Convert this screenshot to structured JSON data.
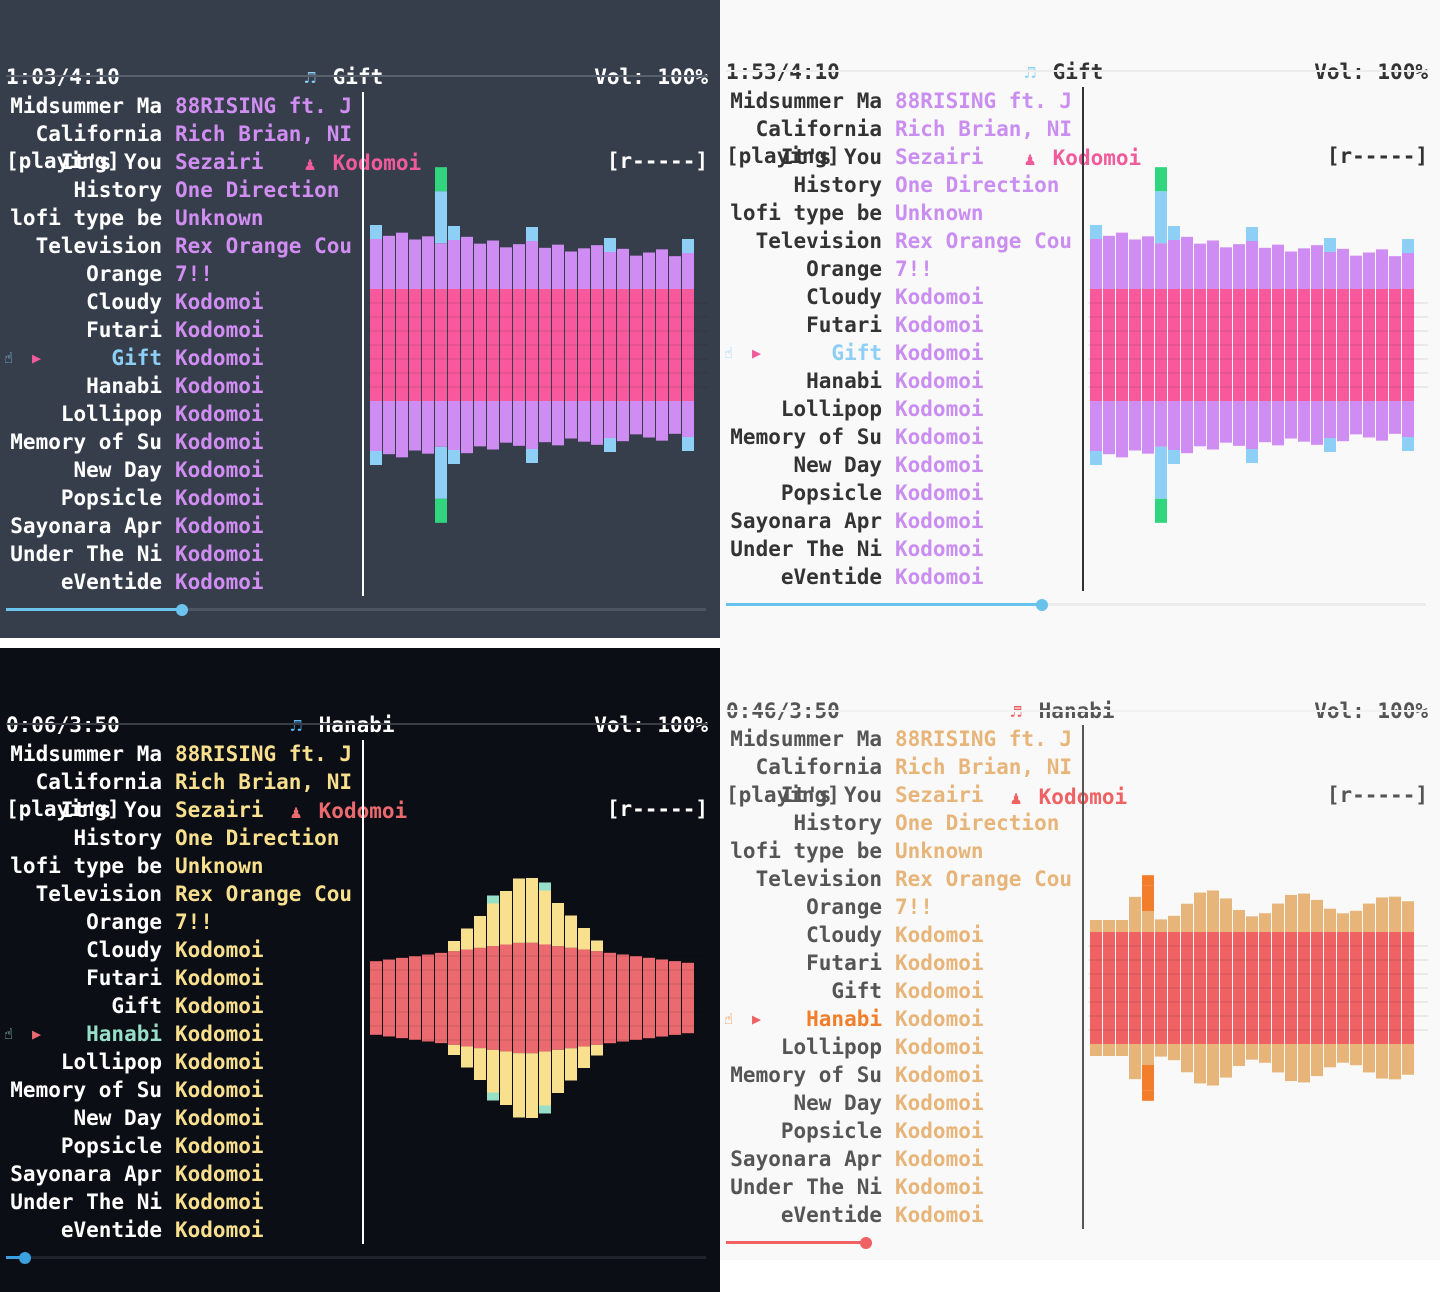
{
  "tracks": [
    {
      "title": "Midsummer Ma",
      "artist": "88RISING ft. J"
    },
    {
      "title": "California",
      "artist": "Rich Brian, NI"
    },
    {
      "title": "It's You",
      "artist": "Sezairi"
    },
    {
      "title": "History",
      "artist": "One Direction"
    },
    {
      "title": "lofi type be",
      "artist": "Unknown"
    },
    {
      "title": "Television",
      "artist": "Rex Orange Cou"
    },
    {
      "title": "Orange",
      "artist": "7!!"
    },
    {
      "title": "Cloudy",
      "artist": "Kodomoi"
    },
    {
      "title": "Futari",
      "artist": "Kodomoi"
    },
    {
      "title": "Gift",
      "artist": "Kodomoi"
    },
    {
      "title": "Hanabi",
      "artist": "Kodomoi"
    },
    {
      "title": "Lollipop",
      "artist": "Kodomoi"
    },
    {
      "title": "Memory of Su",
      "artist": "Kodomoi"
    },
    {
      "title": "New Day",
      "artist": "Kodomoi"
    },
    {
      "title": "Popsicle",
      "artist": "Kodomoi"
    },
    {
      "title": "Sayonara Apr",
      "artist": "Kodomoi"
    },
    {
      "title": "Under The Ni",
      "artist": "Kodomoi"
    },
    {
      "title": "eVentide",
      "artist": "Kodomoi"
    }
  ],
  "panels": [
    {
      "theme": "dark-slate",
      "time": "1:03/4:10",
      "status": "[playing]",
      "now_title": "Gift",
      "now_artist": "Kodomoi",
      "volume": "Vol: 100%",
      "mode": "[r-----]",
      "current_index": 9,
      "progress": 0.252,
      "icons": {
        "note": "music-note-icon",
        "artist": "person-icon",
        "pointer": "pointing-hand-icon",
        "play": "play-arrow-icon"
      },
      "colors": {
        "bg": "#373e4b",
        "text": "#ffffff",
        "artist": "#d18ef2",
        "accent": "#f25b9b",
        "selected": "#8ecff5",
        "sep": "#59606d",
        "progress": "#6bc3ee",
        "track_bg": "#4c5361",
        "outer": "#8ed0f5",
        "peak": "#30d57e",
        "mid": "#cf8cf2",
        "core": "#f7599c"
      }
    },
    {
      "theme": "light",
      "time": "1:53/4:10",
      "status": "[playing]",
      "now_title": "Gift",
      "now_artist": "Kodomoi",
      "volume": "Vol: 100%",
      "mode": "[r-----]",
      "current_index": 9,
      "progress": 0.451,
      "icons": {
        "note": "music-note-icon",
        "artist": "person-icon",
        "pointer": "pointing-hand-icon",
        "play": "play-arrow-icon"
      },
      "colors": {
        "bg": "#f9f9f9",
        "text": "#333333",
        "artist": "#c98ef0",
        "accent": "#f25b9b",
        "selected": "#8ecff5",
        "sep": "#ececec",
        "progress": "#67c2ec",
        "track_bg": "#ececec",
        "outer": "#8ed0f5",
        "peak": "#30d57e",
        "mid": "#cf8cf2",
        "core": "#f7599c"
      }
    },
    {
      "theme": "dark",
      "time": "0:06/3:50",
      "status": "[playing]",
      "now_title": "Hanabi",
      "now_artist": "Kodomoi",
      "volume": "Vol: 100%",
      "mode": "[r-----]",
      "current_index": 10,
      "progress": 0.027,
      "icons": {
        "note": "music-note-icon",
        "artist": "person-icon",
        "pointer": "pointing-hand-icon",
        "play": "play-arrow-icon"
      },
      "colors": {
        "bg": "#0b0e14",
        "text": "#ffffff",
        "artist": "#f8e08e",
        "accent": "#eb6a6f",
        "selected": "#97e0c7",
        "sep": "#3a3d44",
        "progress": "#3aa0e0",
        "track_bg": "#1f232b",
        "outer": "#97e0c7",
        "peak": "#97e0c7",
        "mid": "#f8e08e",
        "core": "#eb6a6f"
      }
    },
    {
      "theme": "light-warm",
      "time": "0:46/3:50",
      "status": "[playing]",
      "now_title": "Hanabi",
      "now_artist": "Kodomoi",
      "volume": "Vol: 100%",
      "mode": "[r-----]",
      "current_index": 10,
      "progress": 0.2,
      "icons": {
        "note": "music-note-icon",
        "artist": "person-icon",
        "pointer": "pointing-hand-icon",
        "play": "play-arrow-icon"
      },
      "colors": {
        "bg": "#f9f9f9",
        "text": "#555555",
        "artist": "#e7b57a",
        "accent": "#ef6163",
        "selected": "#f27e2c",
        "sep": "#f2f2f2",
        "progress": "#ef6163",
        "track_bg": "#f9f9f9",
        "outer": "#f27e2c",
        "peak": "#f27e2c",
        "mid": "#e7b57a",
        "core": "#ef6163"
      }
    }
  ]
}
